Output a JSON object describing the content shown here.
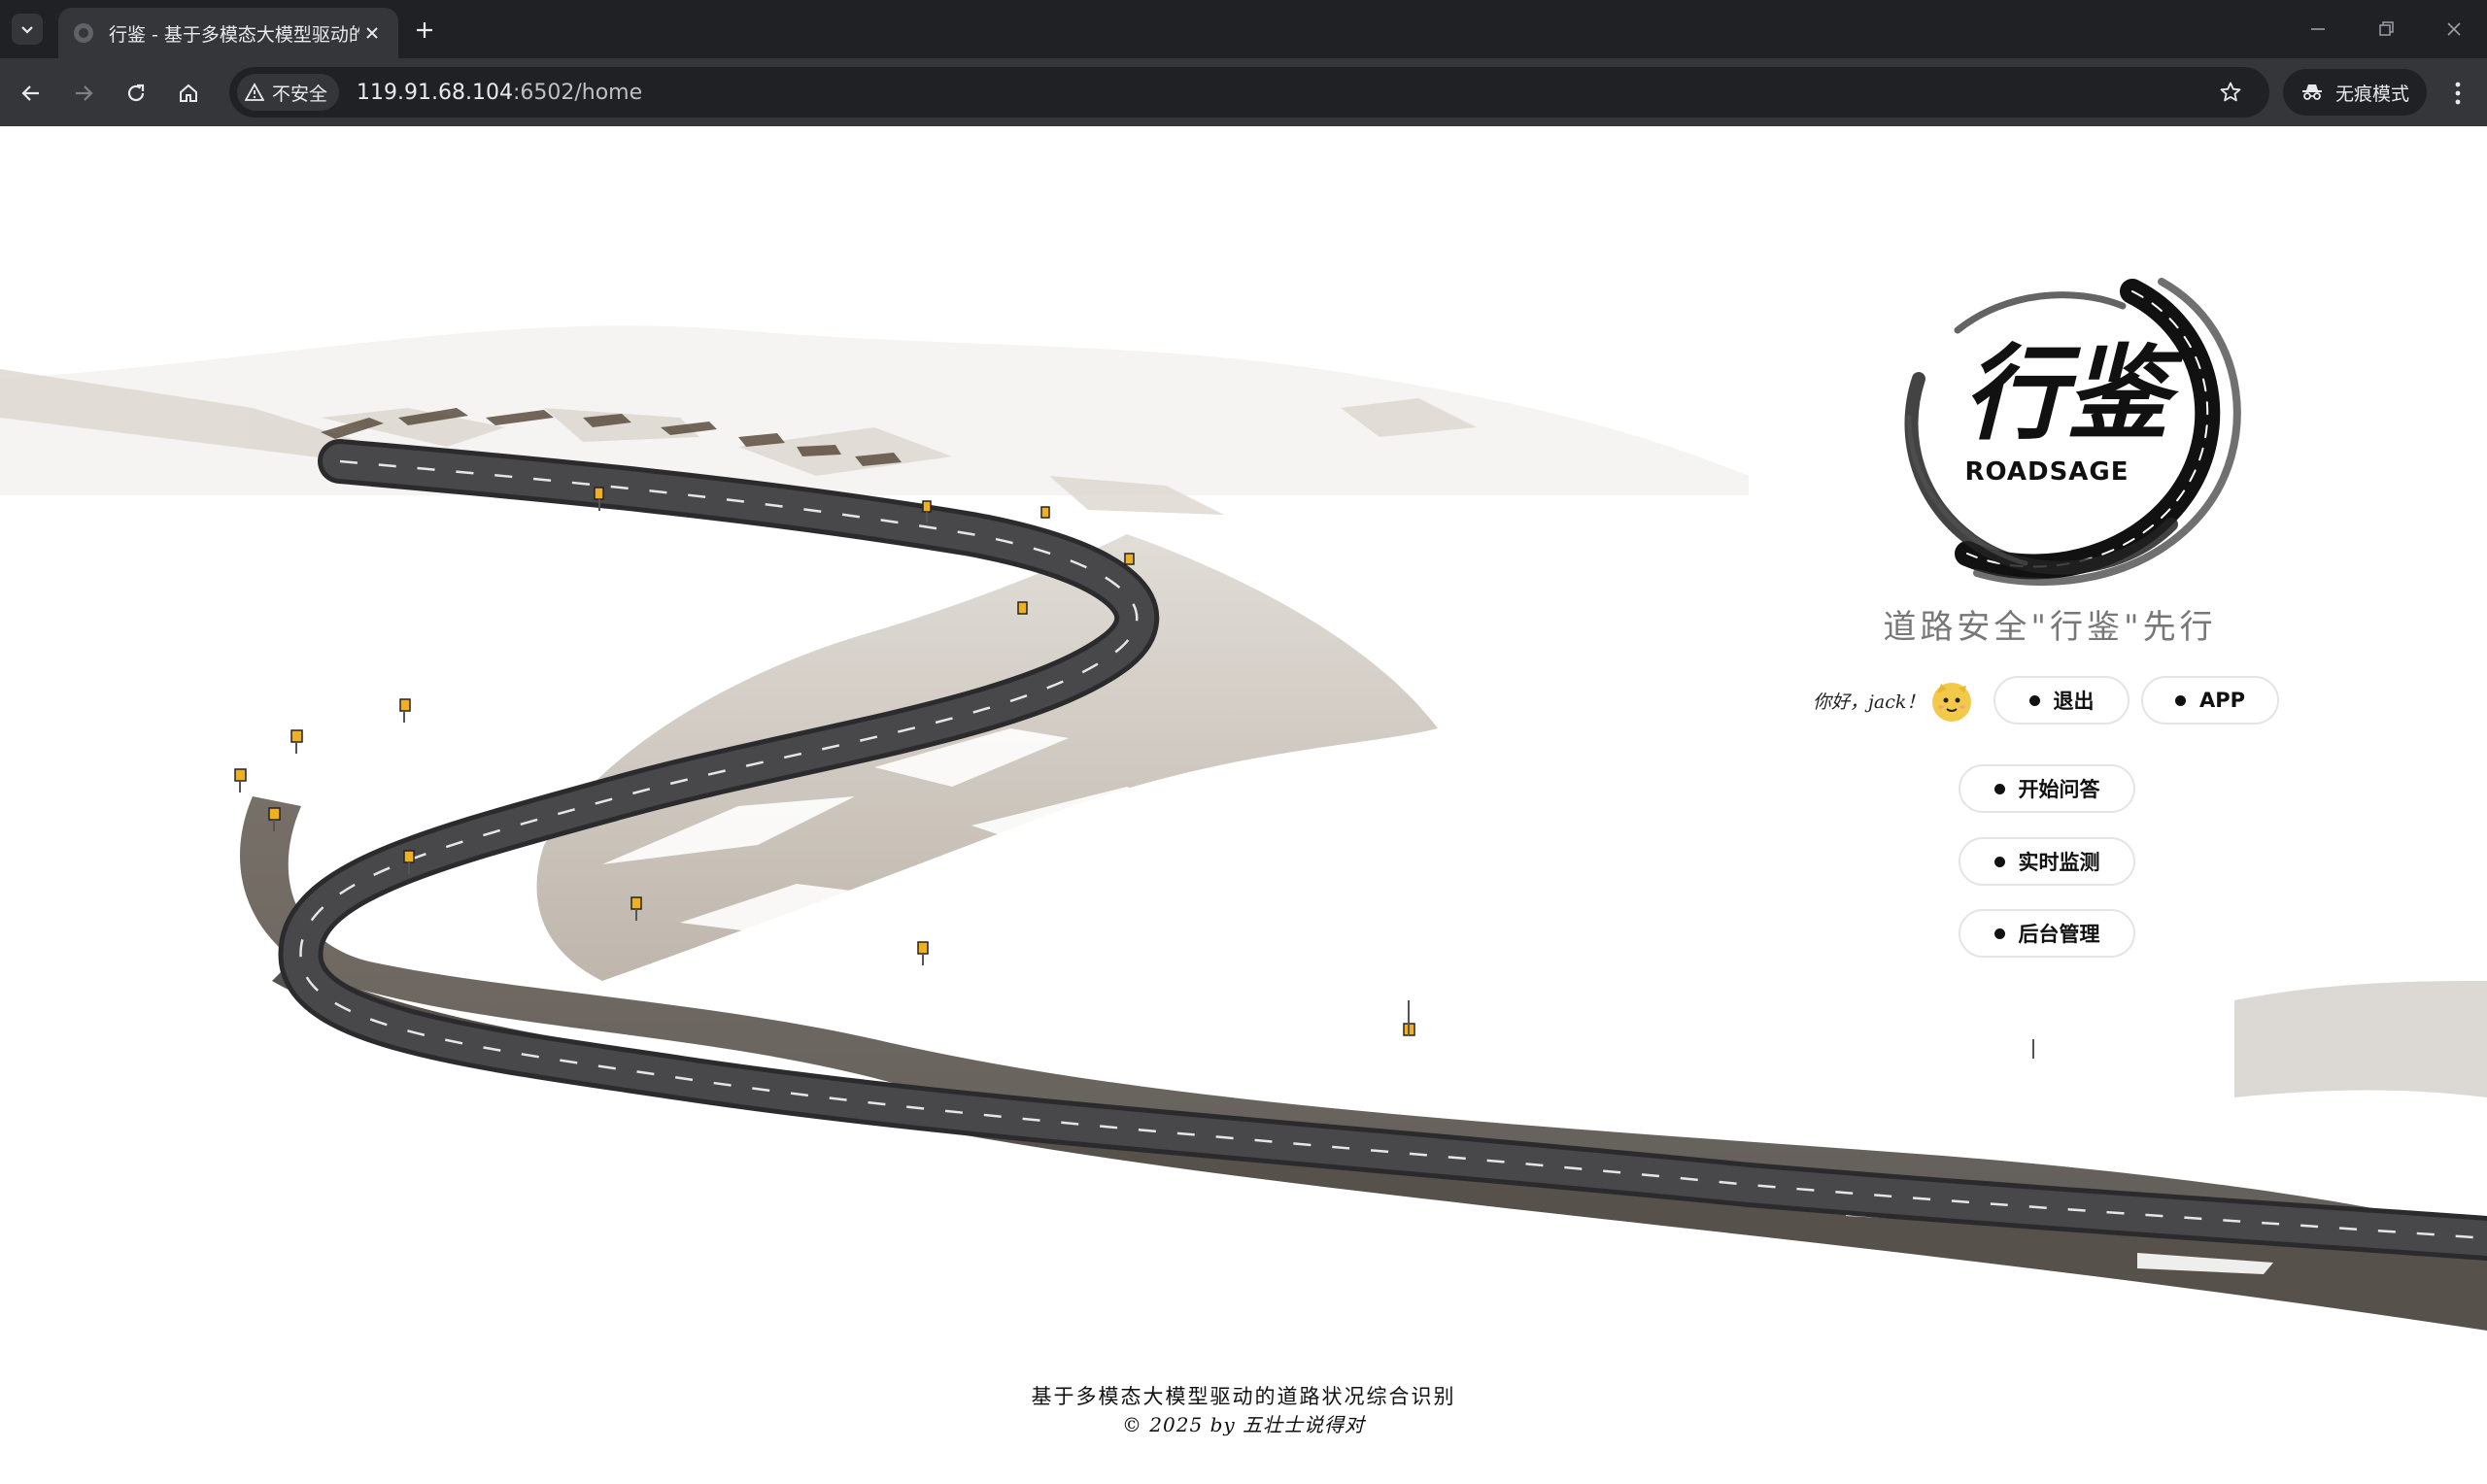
{
  "browser": {
    "tab_title": "行鉴 - 基于多模态大模型驱动的",
    "security_label": "不安全",
    "url_host": "119.91.68.104",
    "url_rest": ":6502/home",
    "incognito_label": "无痕模式",
    "icons": [
      "tab-search-icon",
      "favicon-icon",
      "close-icon",
      "plus-icon",
      "minimize-icon",
      "restore-icon",
      "window-close-icon",
      "back-arrow-icon",
      "forward-arrow-icon",
      "reload-icon",
      "home-icon",
      "warning-triangle-icon",
      "star-icon",
      "incognito-icon",
      "more-vert-icon"
    ]
  },
  "page": {
    "logo_text": "行鉴",
    "logo_subtitle": "ROADSAGE",
    "slogan": "道路安全\"行鉴\"先行",
    "greeting": "你好，jack！",
    "avatar_icon": "cartoon-avatar-icon",
    "buttons": {
      "logout": "退出",
      "app": "APP",
      "qa": "开始问答",
      "monitor": "实时监测",
      "admin": "后台管理"
    },
    "footer": {
      "title": "基于多模态大模型驱动的道路状况综合识别",
      "copyright": "© 2025 by 五壮士说得对"
    }
  },
  "colors": {
    "chrome_dark": "#202124",
    "chrome_mid": "#35363a",
    "road": "#3d3d3f",
    "snow": "#ffffff",
    "accent_sign": "#f2b01e"
  }
}
